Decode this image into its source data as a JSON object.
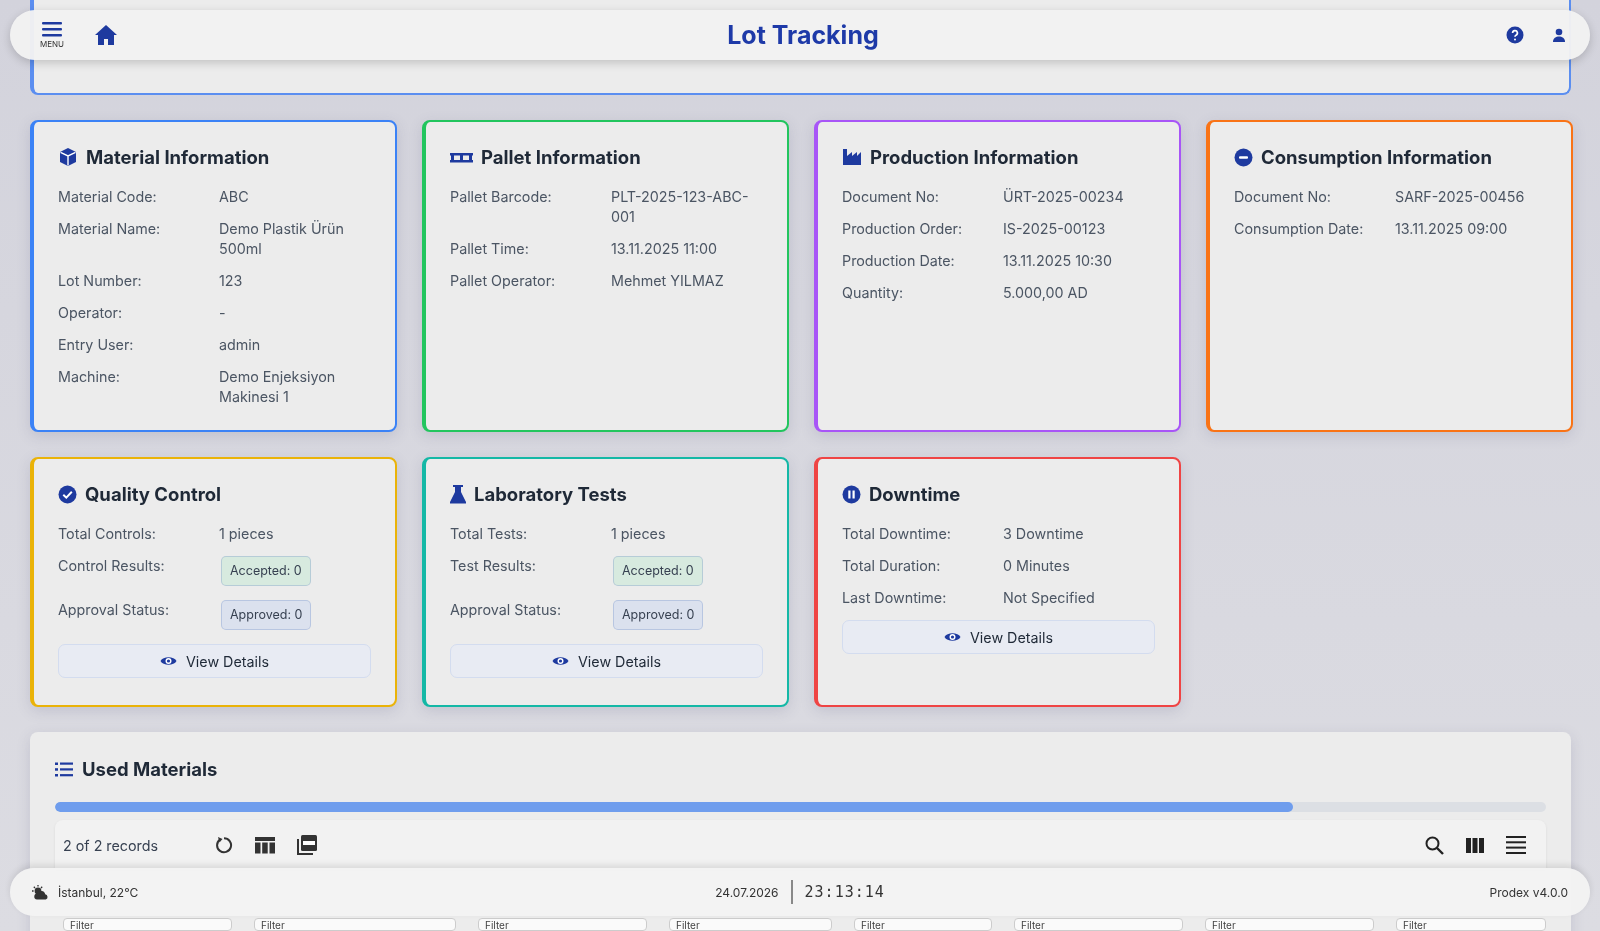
{
  "header": {
    "menu_label": "MENU",
    "title": "Lot Tracking"
  },
  "cards": [
    {
      "title": "Material Information",
      "color": "#3b82f6",
      "fields": [
        {
          "kind": "text",
          "label": "Material Code:",
          "value": "ABC"
        },
        {
          "kind": "text",
          "label": "Material Name:",
          "value": "Demo Plastik Ürün 500ml"
        },
        {
          "kind": "text",
          "label": "Lot Number:",
          "value": "123"
        },
        {
          "kind": "text",
          "label": "Operator:",
          "value": "-"
        },
        {
          "kind": "text",
          "label": "Entry User:",
          "value": "admin"
        },
        {
          "kind": "text",
          "label": "Machine:",
          "value": "Demo Enjeksiyon Makinesi 1"
        }
      ]
    },
    {
      "title": "Pallet Information",
      "color": "#22c55e",
      "fields": [
        {
          "kind": "text",
          "label": "Pallet Barcode:",
          "value": "PLT-2025-123-ABC-001"
        },
        {
          "kind": "text",
          "label": "Pallet Time:",
          "value": "13.11.2025 11:00"
        },
        {
          "kind": "text",
          "label": "Pallet Operator:",
          "value": "Mehmet YILMAZ"
        }
      ]
    },
    {
      "title": "Production Information",
      "color": "#a855f7",
      "fields": [
        {
          "kind": "text",
          "label": "Document No:",
          "value": "ÜRT-2025-00234"
        },
        {
          "kind": "text",
          "label": "Production Order:",
          "value": "IS-2025-00123"
        },
        {
          "kind": "text",
          "label": "Production Date:",
          "value": "13.11.2025 10:30"
        },
        {
          "kind": "text",
          "label": "Quantity:",
          "value": "5.000,00 AD"
        }
      ]
    },
    {
      "title": "Consumption Information",
      "color": "#f97316",
      "fields": [
        {
          "kind": "text",
          "label": "Document No:",
          "value": "SARF-2025-00456"
        },
        {
          "kind": "text",
          "label": "Consumption Date:",
          "value": "13.11.2025 09:00"
        }
      ]
    },
    {
      "title": "Quality Control",
      "color": "#eab308",
      "fields": [
        {
          "kind": "text",
          "label": "Total Controls:",
          "value": "1 pieces"
        },
        {
          "kind": "badge",
          "color": "#d7eadf",
          "label": "Control Results:",
          "value": "Accepted: 0"
        },
        {
          "kind": "badge",
          "color": "#dbe1ee",
          "label": "Approval Status:",
          "value": "Approved: 0"
        }
      ],
      "button": "View Details"
    },
    {
      "title": "Laboratory Tests",
      "color": "#14b8a6",
      "fields": [
        {
          "kind": "text",
          "label": "Total Tests:",
          "value": "1 pieces"
        },
        {
          "kind": "badge",
          "color": "#d7eadf",
          "label": "Test Results:",
          "value": "Accepted: 0"
        },
        {
          "kind": "badge",
          "color": "#dbe1ee",
          "label": "Approval Status:",
          "value": "Approved: 0"
        }
      ],
      "button": "View Details"
    },
    {
      "title": "Downtime",
      "color": "#ef4444",
      "fields": [
        {
          "kind": "text",
          "label": "Total Downtime:",
          "value": "3 Downtime"
        },
        {
          "kind": "text",
          "label": "Total Duration:",
          "value": "0 Minutes"
        },
        {
          "kind": "text",
          "label": "Last Downtime:",
          "value": "Not Specified"
        }
      ],
      "button": "View Details"
    }
  ],
  "used_materials": {
    "title": "Used Materials",
    "progress": {
      "level": 0.83
    },
    "records": "2 of 2 records",
    "filters": [
      {
        "placeholder": "Filter"
      },
      {
        "placeholder": "Filter"
      },
      {
        "placeholder": "Filter"
      },
      {
        "placeholder": "Filter"
      },
      {
        "placeholder": "Filter"
      },
      {
        "placeholder": "Filter"
      },
      {
        "placeholder": "Filter"
      },
      {
        "placeholder": "Filter"
      }
    ]
  },
  "footer": {
    "weather": "İstanbul, 22°C",
    "date": "24.07.2026",
    "time": "23:13:14",
    "version": "Prodex v4.0.0"
  }
}
